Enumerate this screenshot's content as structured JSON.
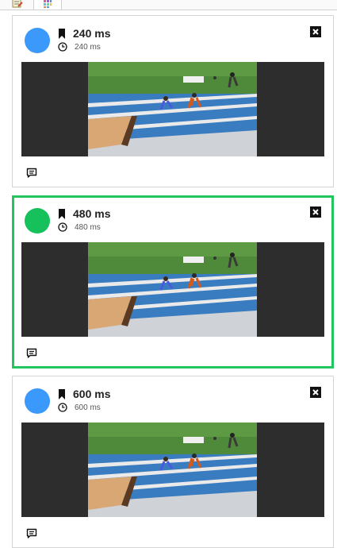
{
  "tabs": [
    {
      "icon": "notes-icon"
    },
    {
      "icon": "grid-icon",
      "active": true
    }
  ],
  "cards": [
    {
      "title": "240 ms",
      "subtitle": "240 ms",
      "avatar_color": "#3b99fc",
      "selected": false
    },
    {
      "title": "480 ms",
      "subtitle": "480 ms",
      "avatar_color": "#16c05a",
      "selected": true
    },
    {
      "title": "600 ms",
      "subtitle": "600 ms",
      "avatar_color": "#3b99fc",
      "selected": false
    }
  ],
  "colors": {
    "selected_border": "#22c55e",
    "frame_bg": "#2d2d2d"
  }
}
